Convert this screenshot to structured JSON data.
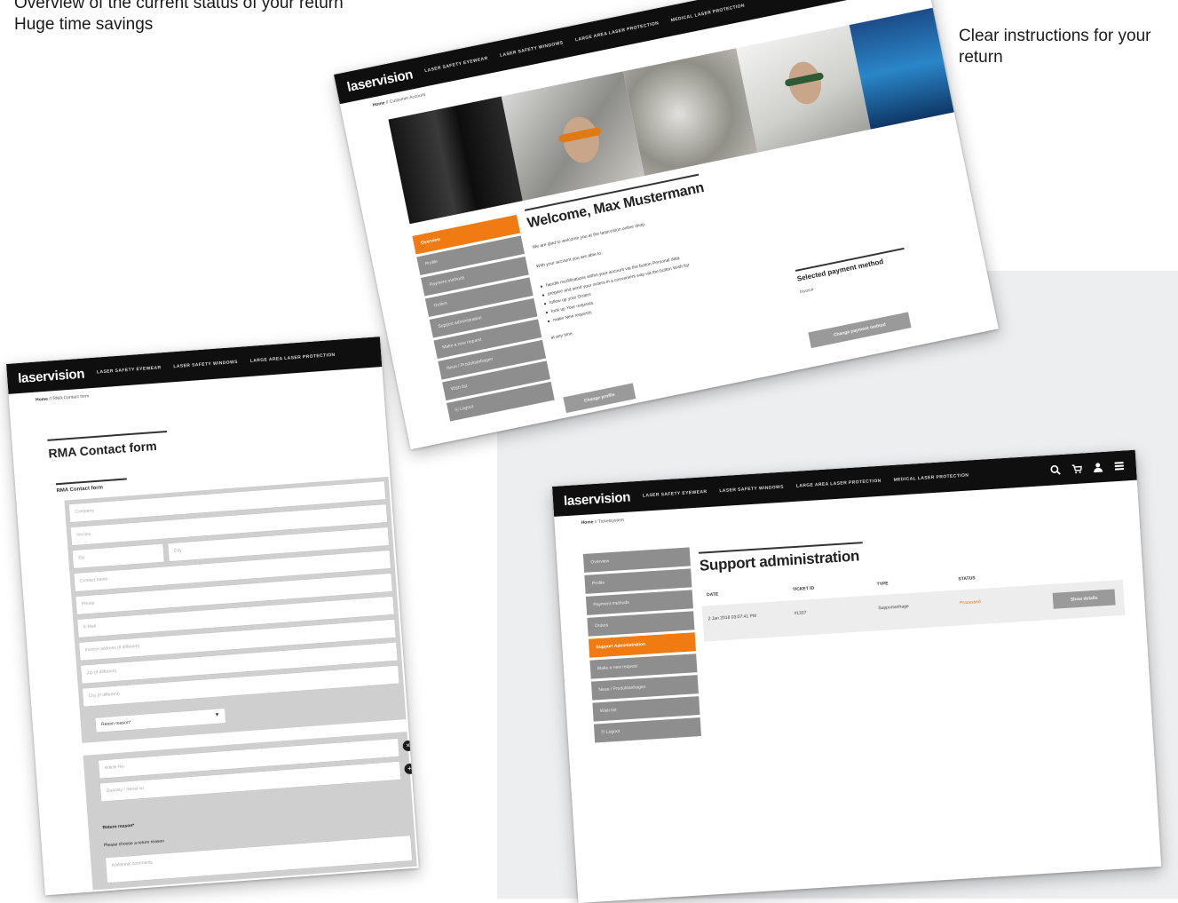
{
  "captions": {
    "top_left": [
      "Overview of the current status of your return",
      "Huge time savings"
    ],
    "top_right": "Clear instructions for your return"
  },
  "colors": {
    "accent": "#f07b13",
    "nav_bg": "#0f0f0f",
    "menu_gray": "#8e8e8e"
  },
  "nav": {
    "logo": "laservision",
    "links": [
      "LASER SAFETY EYEWEAR",
      "LASER SAFETY WINDOWS",
      "LARGE AREA LASER PROTECTION",
      "MEDICAL LASER PROTECTION"
    ],
    "icons": [
      "search-icon",
      "cart-icon",
      "user-icon",
      "menu-icon"
    ]
  },
  "screen_account": {
    "breadcrumb_home": "Home",
    "breadcrumb_current": "Customer Account",
    "welcome_title": "Welcome, Max Mustermann",
    "intro": "We are glad to welcome you at the laservision online shop.",
    "able_text_pre": "With your account you are able to:",
    "bullets": [
      "handle modifications within your account via the button Personal data",
      "prepare and send your orders in a convenient way via the button Wish list",
      "follow up your Orders",
      "look up Your requests",
      "make New requests"
    ],
    "note": "at any time.",
    "menu": [
      "Overview",
      "Profile",
      "Payment methods",
      "Orders",
      "Support administration",
      "Make a new request",
      "Neue / Produktanfragen",
      "Wish list",
      "Logout"
    ],
    "payment_title": "Selected payment method",
    "payment_value": "Invoice",
    "change_payment_button": "Change payment method",
    "change_profile_button": "Change profile"
  },
  "screen_rma": {
    "breadcrumb_home": "Home",
    "breadcrumb_current": "RMA Contact form",
    "title": "RMA Contact form",
    "subtitle": "RMA Contact form",
    "placeholders": [
      "Company",
      "Invoice",
      "Zip",
      "City",
      "Contact name",
      "Phone",
      "E-Mail",
      "Invoice address (if different)",
      "Zip (if different)",
      "City (if different)"
    ],
    "select_value": "Return reason*",
    "serial_placeholder": "Article No.",
    "serial_placeholder_2": "Quantity / Serial no.",
    "return_reason_label": "Return reason*",
    "return_reason_hint": "Please choose a return reason",
    "notes_placeholder": "Additional comments"
  },
  "screen_support": {
    "breadcrumb_home": "Home",
    "breadcrumb_current": "Ticketsystem",
    "title": "Support administration",
    "menu": [
      "Overview",
      "Profile",
      "Payment methods",
      "Orders",
      "Support Administration",
      "Make a new request",
      "Neue / Produktanfragen",
      "Wish list",
      "Logout"
    ],
    "columns": [
      "DATE",
      "TICKET ID",
      "TYPE",
      "STATUS"
    ],
    "rows": [
      {
        "date": "2 Jan 2018 03:07:41 PM",
        "ticket_id": "#1337",
        "type": "Supportanfrage",
        "status": "Processed",
        "action": "Show details"
      }
    ]
  }
}
